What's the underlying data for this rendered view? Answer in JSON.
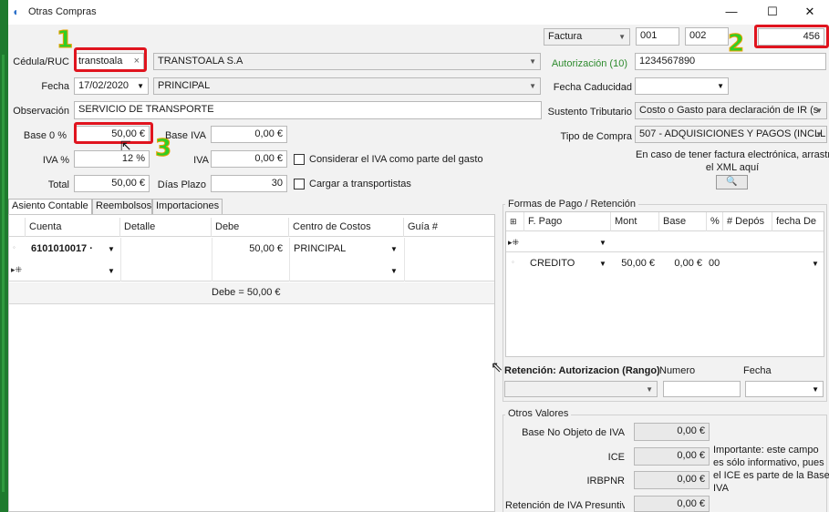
{
  "window": {
    "title": "Otras Compras",
    "minimize_glyph": "—",
    "maximize_glyph": "☐",
    "close_glyph": "✕"
  },
  "markers": {
    "m1": "1",
    "m2": "2",
    "m3": "3"
  },
  "header": {
    "cedula_label": "Cédula/RUC",
    "cedula_value": "transtoala",
    "cedula_clear": "×",
    "proveedor_name": "TRANSTOALA S.A",
    "fecha_label": "Fecha",
    "fecha_value": "17/02/2020",
    "sucursal_value": "PRINCIPAL",
    "observacion_label": "Observación",
    "observacion_value": "SERVICIO DE TRANSPORTE",
    "doc_type": "Factura",
    "serie1": "001",
    "serie2": "002",
    "numero": "456",
    "autorizacion_label": "Autorización (10)",
    "autorizacion_value": "1234567890",
    "fecha_caducidad_label": "Fecha Caducidad",
    "fecha_caducidad_value": "",
    "sustento_label": "Sustento Tributario",
    "sustento_value": "Costo o Gasto para declaración de IR (s",
    "tipo_compra_label": "Tipo de Compra",
    "tipo_compra_value": "507 - ADQUISICIONES Y PAGOS (INCLL",
    "xml_hint_1": "En caso de tener factura electrónica, arrastre",
    "xml_hint_2": "el XML aquí",
    "xml_button_icon": "🔍"
  },
  "totals": {
    "base0_label": "Base 0 %",
    "base0_value": "50,00 €",
    "base_iva_label": "Base IVA",
    "base_iva_value": "0,00 €",
    "iva_pct_label": "IVA %",
    "iva_pct_value": "12 %",
    "iva_label": "IVA",
    "iva_value": "0,00 €",
    "total_label": "Total",
    "total_value": "50,00 €",
    "dias_plazo_label": "Días Plazo",
    "dias_plazo_value": "30",
    "considerar_iva_label": "Considerar el IVA como parte del gasto",
    "cargar_transportistas_label": "Cargar a transportistas"
  },
  "tabs": [
    {
      "label": "Asiento Contable"
    },
    {
      "label": "Reembolsos"
    },
    {
      "label": "Importaciones"
    }
  ],
  "asiento": {
    "columns": [
      "Cuenta",
      "Detalle",
      "Debe",
      "Centro de Costos",
      "Guía #"
    ],
    "rows": [
      {
        "cuenta": "6101010017 ·",
        "detalle": "",
        "debe": "50,00 €",
        "centro": "PRINCIPAL",
        "guia": ""
      }
    ],
    "footer": "Debe = 50,00 €"
  },
  "formas_pago": {
    "title": "Formas de Pago / Retención",
    "columns": [
      "F. Pago",
      "Mont",
      "Base",
      "%",
      "# Depós",
      "fecha De"
    ],
    "rows": [
      {
        "fpago": "CREDITO",
        "monto": "50,00 €",
        "base": "0,00 €",
        "pct": "00"
      }
    ],
    "retencion_label": "Retención: Autorizacion (Rango)",
    "numero_label": "Numero",
    "fecha_label": "Fecha"
  },
  "otros_valores": {
    "title": "Otros Valores",
    "base_no_objeto_label": "Base No Objeto de IVA",
    "base_no_objeto_value": "0,00 €",
    "ice_label": "ICE",
    "ice_value": "0,00 €",
    "irbpnr_label": "IRBPNR",
    "irbpnr_value": "0,00 €",
    "retencion_iva_label": "Retención de IVA Presuntiv",
    "retencion_iva_value": "0,00 €",
    "note_1": "Importante: este campo",
    "note_2": "es sólo informativo, pues",
    "note_3": "el ICE es parte de la Base",
    "note_4": "IVA"
  },
  "colors": {
    "highlight_red": "#e0141e",
    "marker_green": "#2fcf25",
    "accent_green_text": "#2e8b2e"
  }
}
